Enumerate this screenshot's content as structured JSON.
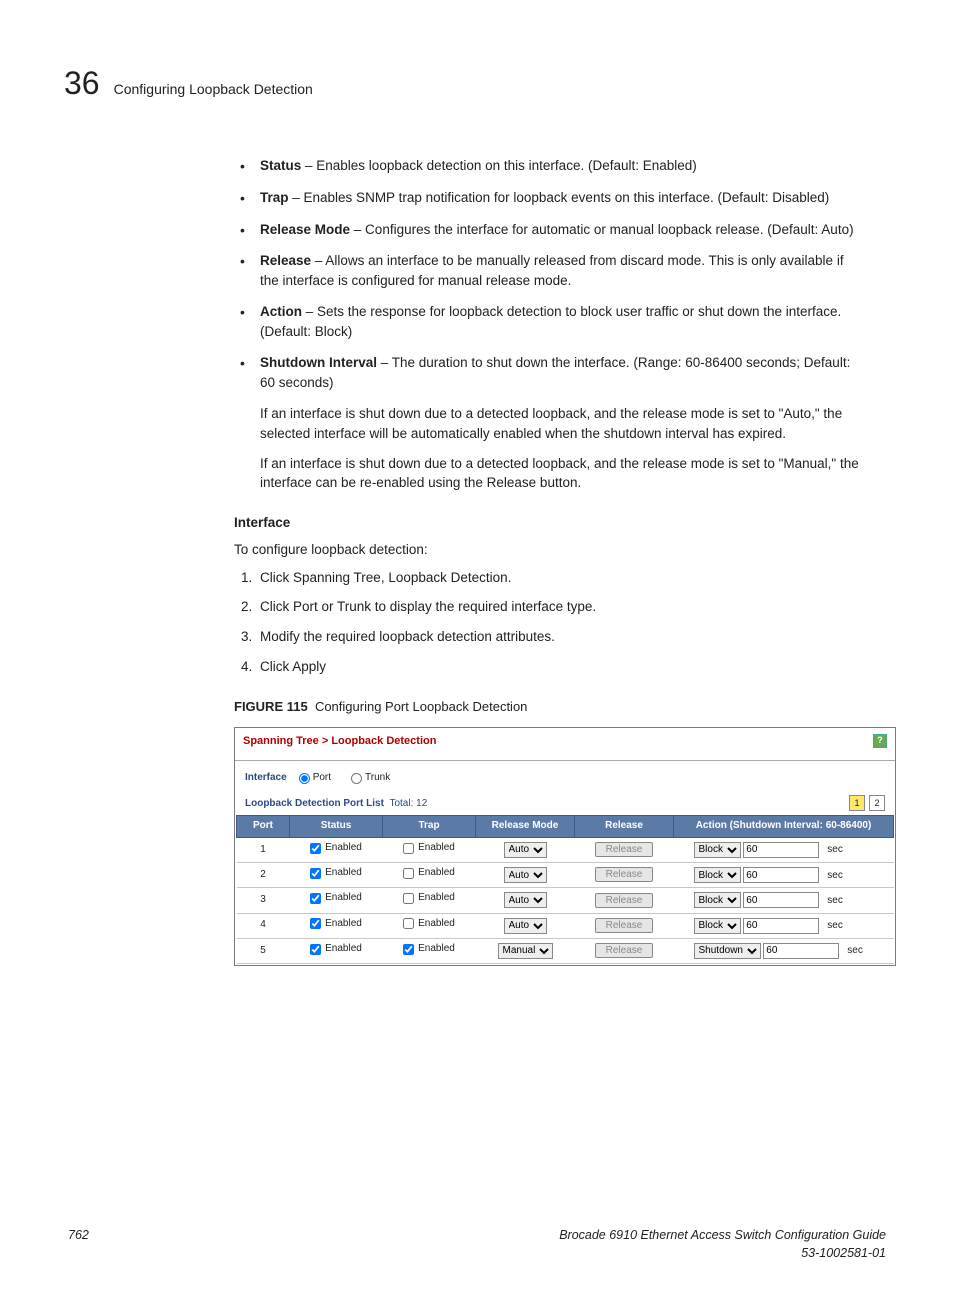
{
  "header": {
    "chapter_number": "36",
    "chapter_title": "Configuring Loopback Detection"
  },
  "bullets": [
    {
      "term": "Status",
      "text": " – Enables loopback detection on this interface. (Default: Enabled)"
    },
    {
      "term": "Trap",
      "text": " – Enables SNMP trap notification for loopback events on this interface. (Default: Disabled)"
    },
    {
      "term": "Release Mode",
      "text": " – Configures the interface for automatic or manual loopback release. (Default: Auto)"
    },
    {
      "term": "Release",
      "text": " – Allows an interface to be manually released from discard mode. This is only available if the interface is configured for manual release mode."
    },
    {
      "term": "Action",
      "text": " – Sets the response for loopback detection to block user traffic or shut down the interface. (Default: Block)"
    },
    {
      "term": "Shutdown Interval",
      "text": " – The duration to shut down the interface. (Range: 60-86400 seconds; Default: 60 seconds)"
    }
  ],
  "after_paragraphs": [
    "If an interface is shut down due to a detected loopback, and the release mode is set to \"Auto,\" the selected interface will be automatically enabled when the shutdown interval has expired.",
    "If an interface is shut down due to a detected loopback, and the release mode is set to \"Manual,\" the interface can be re-enabled using the Release button."
  ],
  "interface_section": {
    "heading": "Interface",
    "intro": "To configure loopback detection:",
    "steps": [
      "Click Spanning Tree, Loopback Detection.",
      "Click Port or Trunk to display the required interface type.",
      "Modify the required loopback detection attributes.",
      "Click Apply"
    ]
  },
  "figure": {
    "label": "FIGURE 115",
    "caption": "Configuring Port Loopback Detection"
  },
  "ui": {
    "breadcrumb": "Spanning Tree > Loopback Detection",
    "help": "?",
    "interface_label": "Interface",
    "radio_port": "Port",
    "radio_trunk": "Trunk",
    "list_title": "Loopback Detection Port List",
    "list_total_label": "Total:",
    "list_total_value": "12",
    "pager": [
      "1",
      "2"
    ],
    "columns": [
      "Port",
      "Status",
      "Trap",
      "Release Mode",
      "Release",
      "Action (Shutdown Interval: 60-86400)"
    ],
    "enabled_label": "Enabled",
    "release_btn": "Release",
    "sec_label": "sec",
    "rows": [
      {
        "port": "1",
        "status": true,
        "trap": false,
        "mode": "Auto",
        "action": "Block",
        "interval": "60"
      },
      {
        "port": "2",
        "status": true,
        "trap": false,
        "mode": "Auto",
        "action": "Block",
        "interval": "60"
      },
      {
        "port": "3",
        "status": true,
        "trap": false,
        "mode": "Auto",
        "action": "Block",
        "interval": "60"
      },
      {
        "port": "4",
        "status": true,
        "trap": false,
        "mode": "Auto",
        "action": "Block",
        "interval": "60"
      },
      {
        "port": "5",
        "status": true,
        "trap": true,
        "mode": "Manual",
        "action": "Shutdown",
        "interval": "60"
      }
    ]
  },
  "footer": {
    "page": "762",
    "doc_title": "Brocade 6910 Ethernet Access Switch Configuration Guide",
    "doc_id": "53-1002581-01"
  }
}
